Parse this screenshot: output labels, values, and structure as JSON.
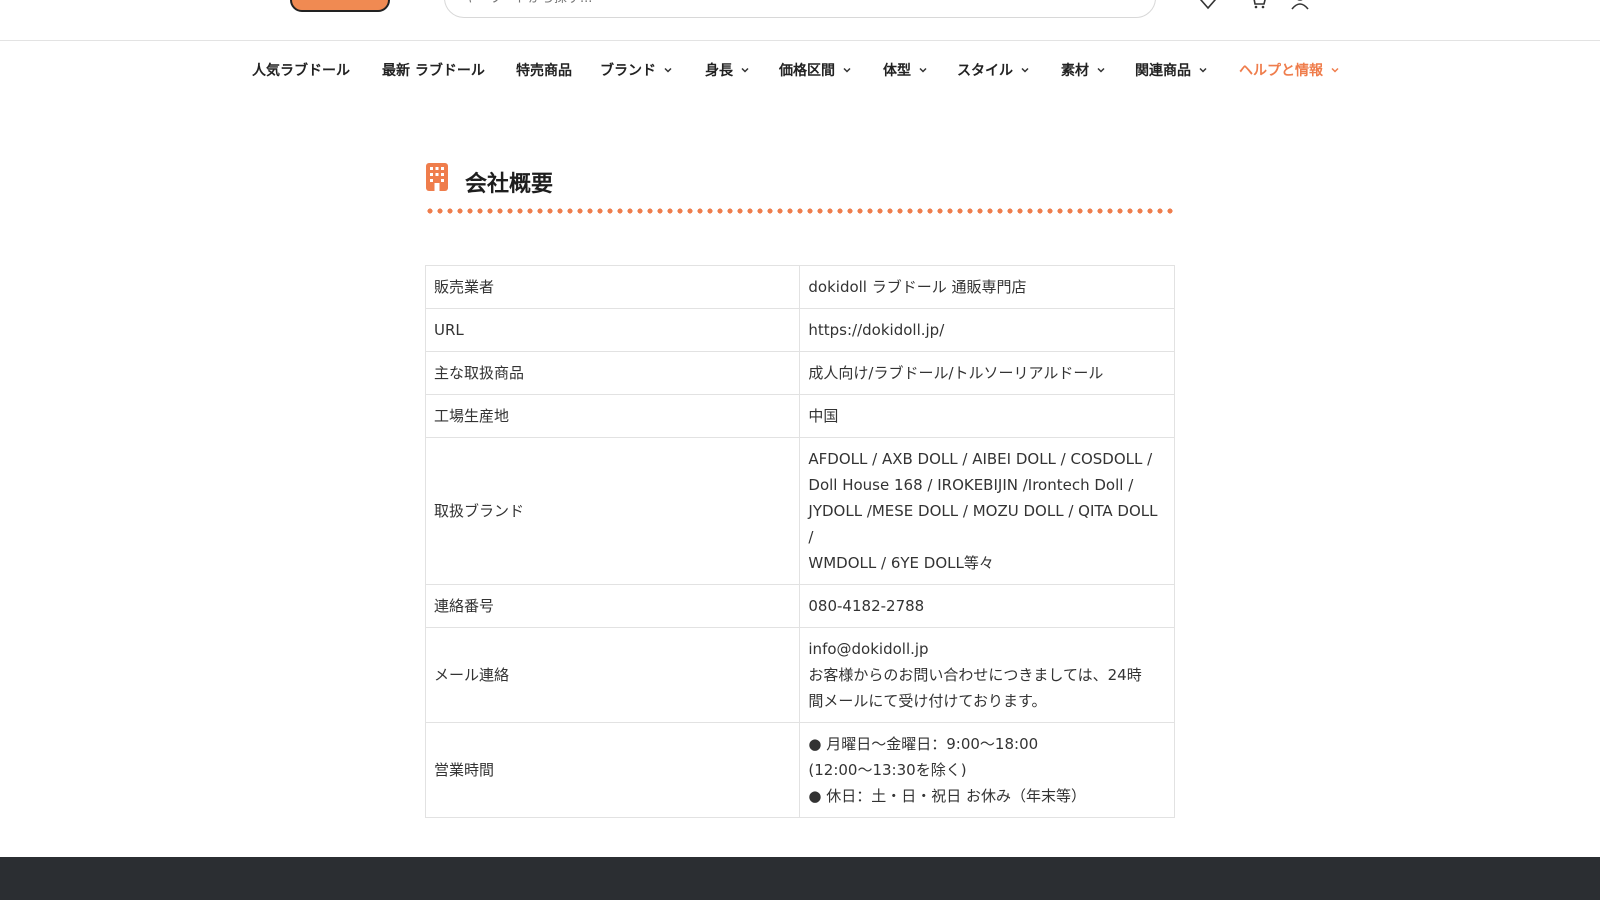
{
  "colors": {
    "accent": "#ef7d4c",
    "footer": "#2b2e32",
    "border": "#e2e2e2"
  },
  "header": {
    "search_placeholder": "キーワードから探す...",
    "icons": [
      "logo",
      "search-icon",
      "wishlist-heart-icon",
      "cart-icon",
      "account-icon"
    ]
  },
  "nav": {
    "items": [
      {
        "label": "人気ラブドール"
      },
      {
        "label": "最新 ラブドール"
      },
      {
        "label": "特売商品"
      },
      {
        "label": "ブランド"
      },
      {
        "label": "身長"
      },
      {
        "label": "価格区間"
      },
      {
        "label": "体型"
      },
      {
        "label": "スタイル"
      },
      {
        "label": "素材"
      },
      {
        "label": "関連商品"
      },
      {
        "label": "ヘルプと情報"
      }
    ]
  },
  "page": {
    "title": "会社概要"
  },
  "company_table": [
    {
      "key": "販売業者",
      "value": "dokidoll ラブドール 通販専門店"
    },
    {
      "key": "URL",
      "value": "https://dokidoll.jp/"
    },
    {
      "key": "主な取扱商品",
      "value": "成人向け/ラブドール/トルソーリアルドール"
    },
    {
      "key": "工場生産地",
      "value": "中国"
    },
    {
      "key": "取扱ブランド",
      "lines": [
        "AFDOLL / AXB DOLL / AIBEI DOLL / COSDOLL /",
        "Doll House 168 / IROKEBIJIN /Irontech Doll /",
        "JYDOLL /MESE DOLL / MOZU DOLL / QITA DOLL /",
        "WMDOLL / 6YE DOLL等々"
      ]
    },
    {
      "key": "連絡番号",
      "value": "080-4182-2788"
    },
    {
      "key": "メール連絡",
      "lines": [
        "info@dokidoll.jp",
        "お客様からのお問い合わせにつきましては、24時",
        "間メールにて受け付けております。"
      ]
    },
    {
      "key": "営業時間",
      "lines": [
        "● 月曜日～金曜日：9:00～18:00",
        "(12:00～13:30を除く)",
        "● 休日：土・日・祝日 お休み（年末等）"
      ]
    }
  ]
}
